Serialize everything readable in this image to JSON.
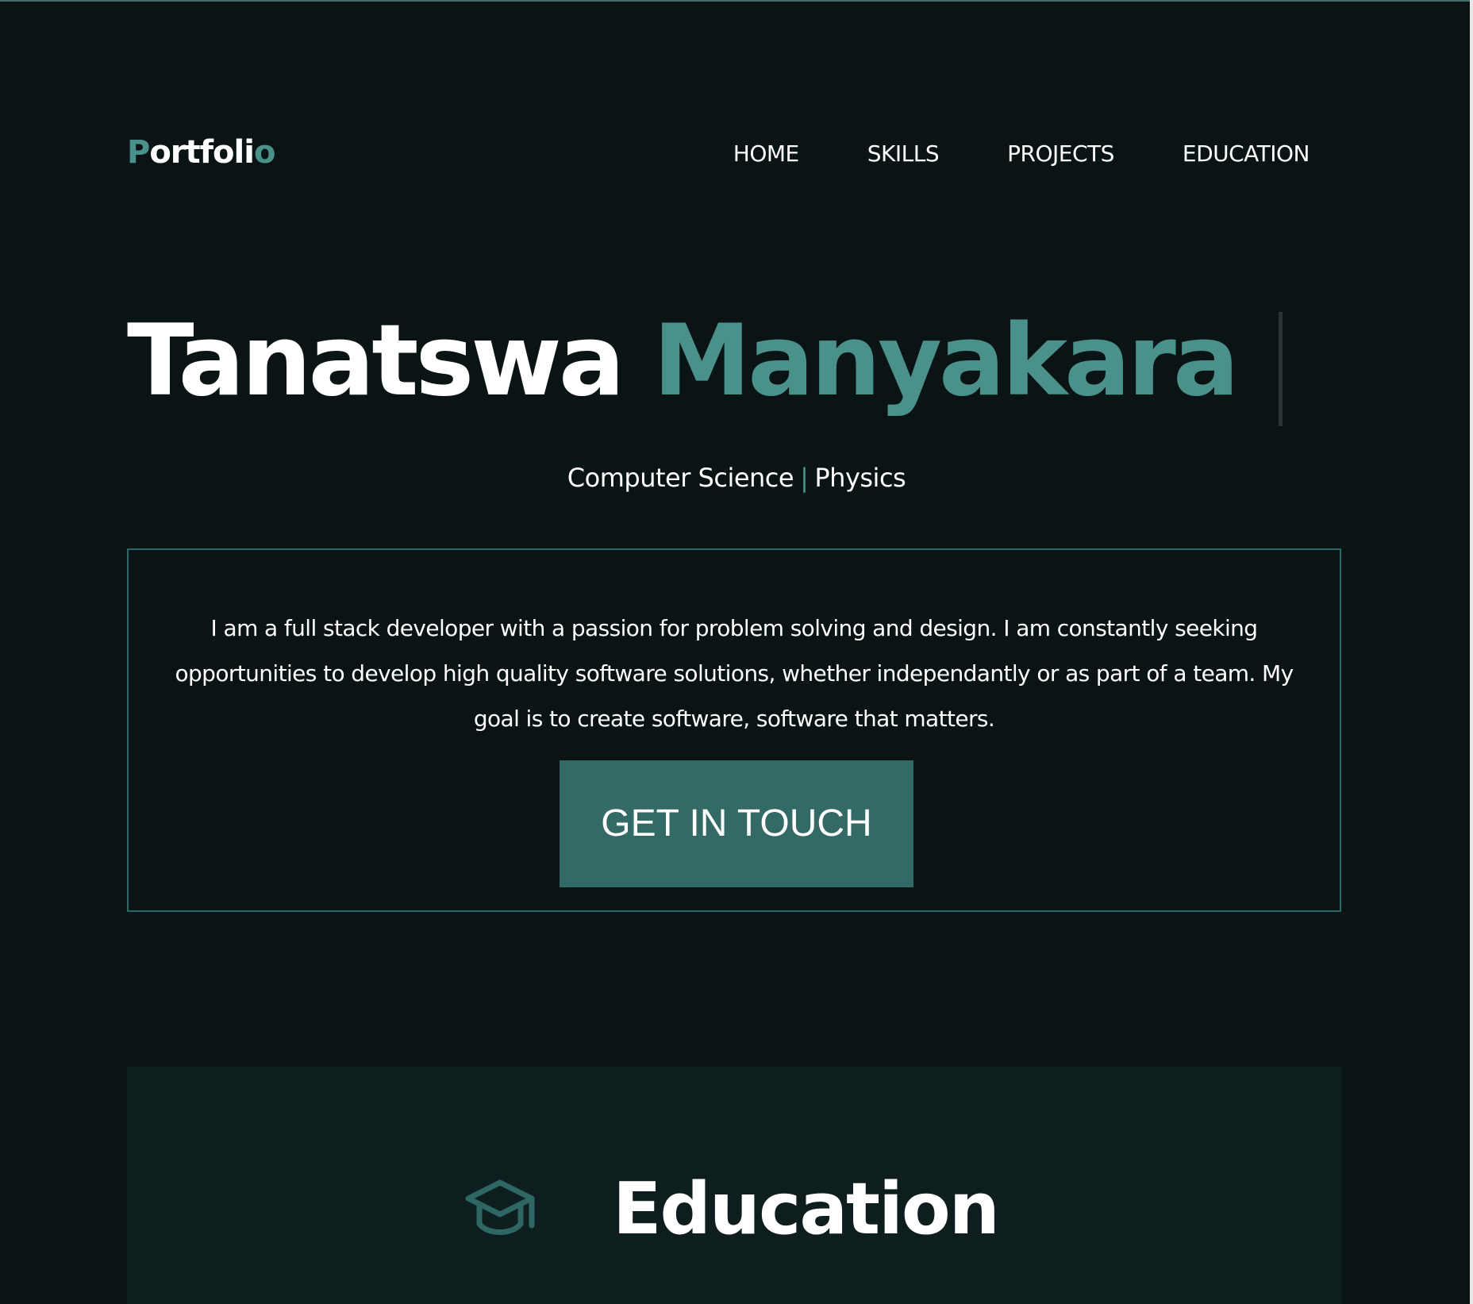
{
  "header": {
    "logo": {
      "first": "P",
      "middle": "ortfoli",
      "last": "o"
    },
    "nav": [
      {
        "label": "HOME"
      },
      {
        "label": "SKILLS"
      },
      {
        "label": "PROJECTS"
      },
      {
        "label": "EDUCATION"
      }
    ]
  },
  "hero": {
    "first_name": "Tanatswa",
    "last_name": "Manyakara",
    "subtitle_left": "Computer Science",
    "subtitle_sep": "|",
    "subtitle_right": "Physics"
  },
  "about": {
    "text": "I am a full stack developer with a passion for problem solving and design. I am constantly seeking opportunities to develop high quality software solutions, whether independantly or as part of a team. My goal is to create software, software that matters.",
    "cta_label": "GET IN TOUCH"
  },
  "education": {
    "title": "Education",
    "icon": "graduation-cap-icon"
  },
  "colors": {
    "background": "#0a1414",
    "accent": "#4a918b",
    "button": "#346a66",
    "panel": "#0e1e1f",
    "border": "#2e6663"
  }
}
